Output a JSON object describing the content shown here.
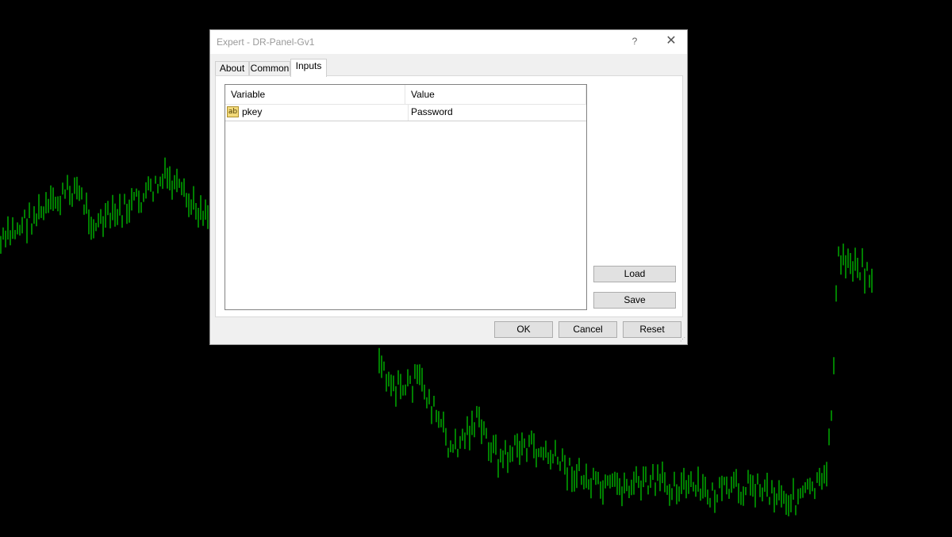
{
  "dialog": {
    "title": "Expert - DR-Panel-Gv1",
    "help_glyph": "?",
    "close_glyph": "✕"
  },
  "tabs": [
    {
      "label": "About",
      "active": false
    },
    {
      "label": "Common",
      "active": false
    },
    {
      "label": "Inputs",
      "active": true
    }
  ],
  "grid": {
    "columns": [
      "Variable",
      "Value"
    ],
    "rows": [
      {
        "icon": "string-param-icon",
        "icon_text": "ab",
        "variable": "pkey",
        "value": "Password"
      }
    ]
  },
  "side_buttons": {
    "load": "Load",
    "save": "Save"
  },
  "footer_buttons": {
    "ok": "OK",
    "cancel": "Cancel",
    "reset": "Reset"
  },
  "colors": {
    "chart_background": "#000000",
    "bars": "#00ff00"
  }
}
